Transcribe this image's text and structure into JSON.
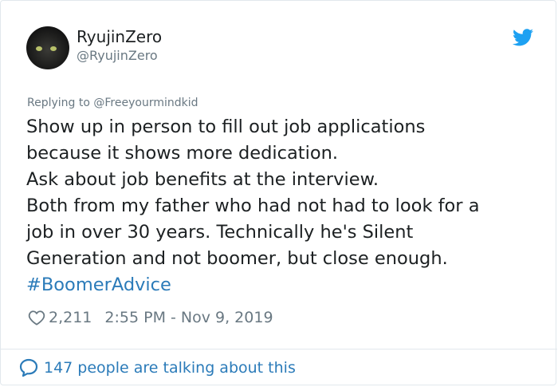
{
  "user": {
    "name": "RyujinZero",
    "handle": "@RyujinZero"
  },
  "reply": {
    "prefix": "Replying to ",
    "mention": "@Freeyourmindkid"
  },
  "tweet": {
    "lines": [
      "Show up in person to fill out job applications",
      "because it shows more dedication.",
      "Ask about job benefits at the interview.",
      "Both from my father who had not had to look for a",
      "job in over 30 years. Technically he's Silent",
      "Generation and not boomer, but close enough."
    ],
    "hashtag": "#BoomerAdvice"
  },
  "meta": {
    "likes": "2,211",
    "timestamp": "2:55 PM - Nov 9, 2019"
  },
  "footer": {
    "conversation": "147 people are talking about this"
  },
  "icons": {
    "brand": "twitter-bird-icon",
    "like": "heart-icon",
    "conversation": "speech-bubble-icon"
  },
  "colors": {
    "accent": "#2b7bb9",
    "twitter_blue": "#1da1f2",
    "muted": "#697882",
    "text": "#1c2022",
    "border": "#e1e8ed"
  }
}
